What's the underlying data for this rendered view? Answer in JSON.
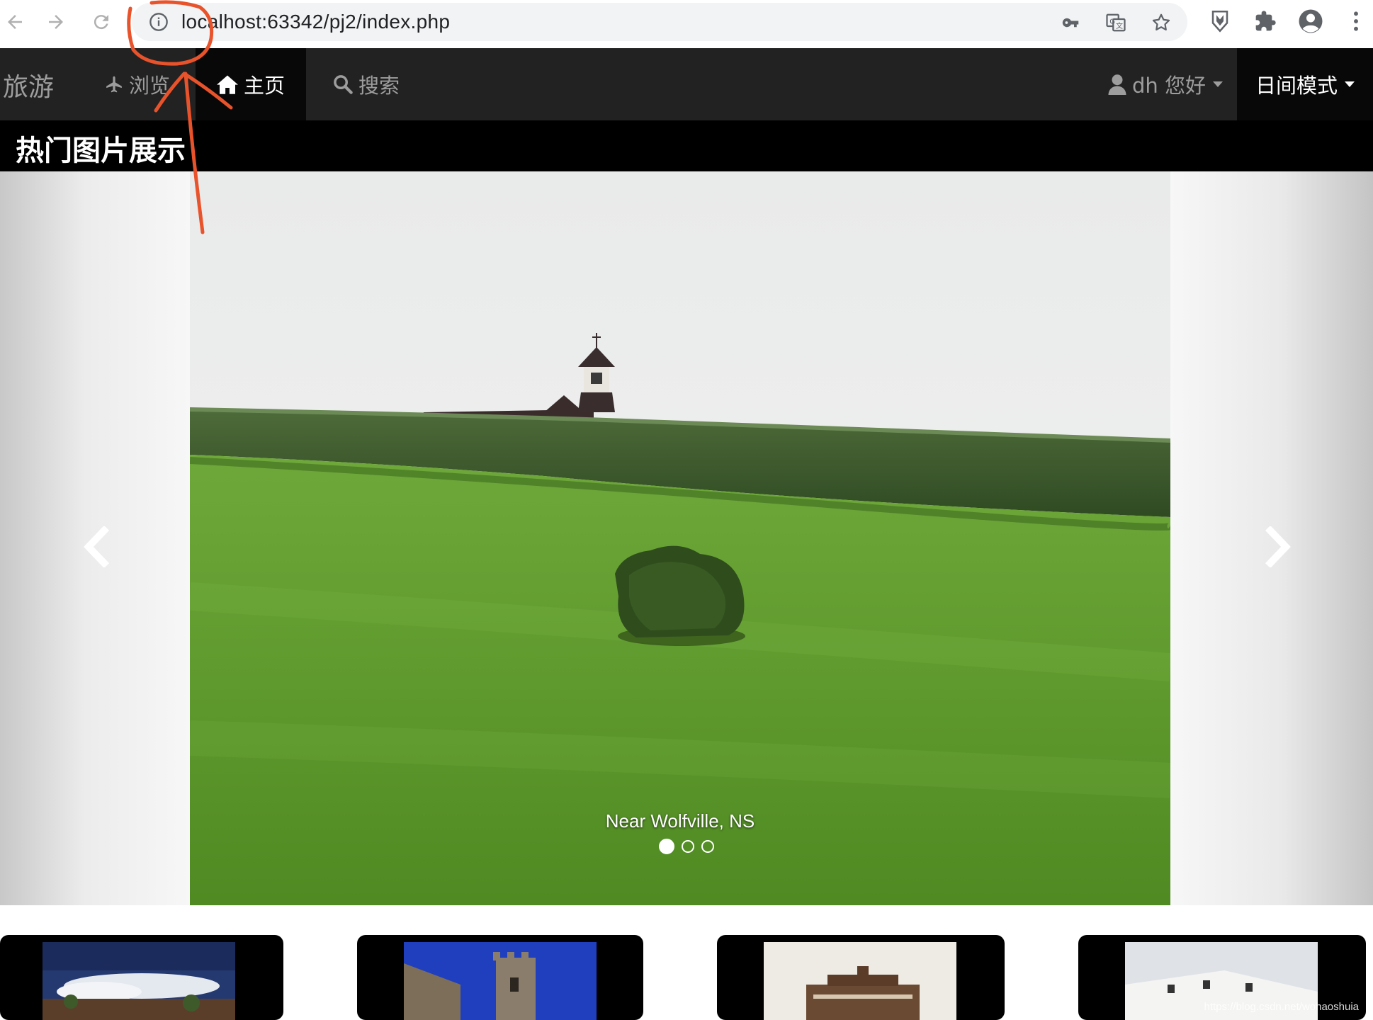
{
  "browser": {
    "url": "localhost:63342/pj2/index.php",
    "icons": {
      "back": "arrow-left-icon",
      "forward": "arrow-right-icon",
      "reload": "reload-icon",
      "info": "info-icon",
      "key": "key-icon",
      "translate": "translate-icon",
      "bookmark": "star-icon",
      "extension_shield": "shield-icon",
      "extensions": "puzzle-icon",
      "profile": "account-icon",
      "menu": "kebab-icon"
    }
  },
  "navbar": {
    "brand": "旅游",
    "browse": "浏览",
    "home": "主页",
    "search": "搜索",
    "user": "dh 您好",
    "mode": "日间模式"
  },
  "section": {
    "title": "热门图片展示"
  },
  "carousel": {
    "caption": "Near Wolfville, NS",
    "indicator_count": 3,
    "active_index": 0
  },
  "watermark": "https://blog.csdn.net/wohaoshuia",
  "colors": {
    "navbar_bg": "#222222",
    "navbar_active_bg": "#080808",
    "navbar_text": "#9d9d9d",
    "annotation": "#e8532b"
  }
}
